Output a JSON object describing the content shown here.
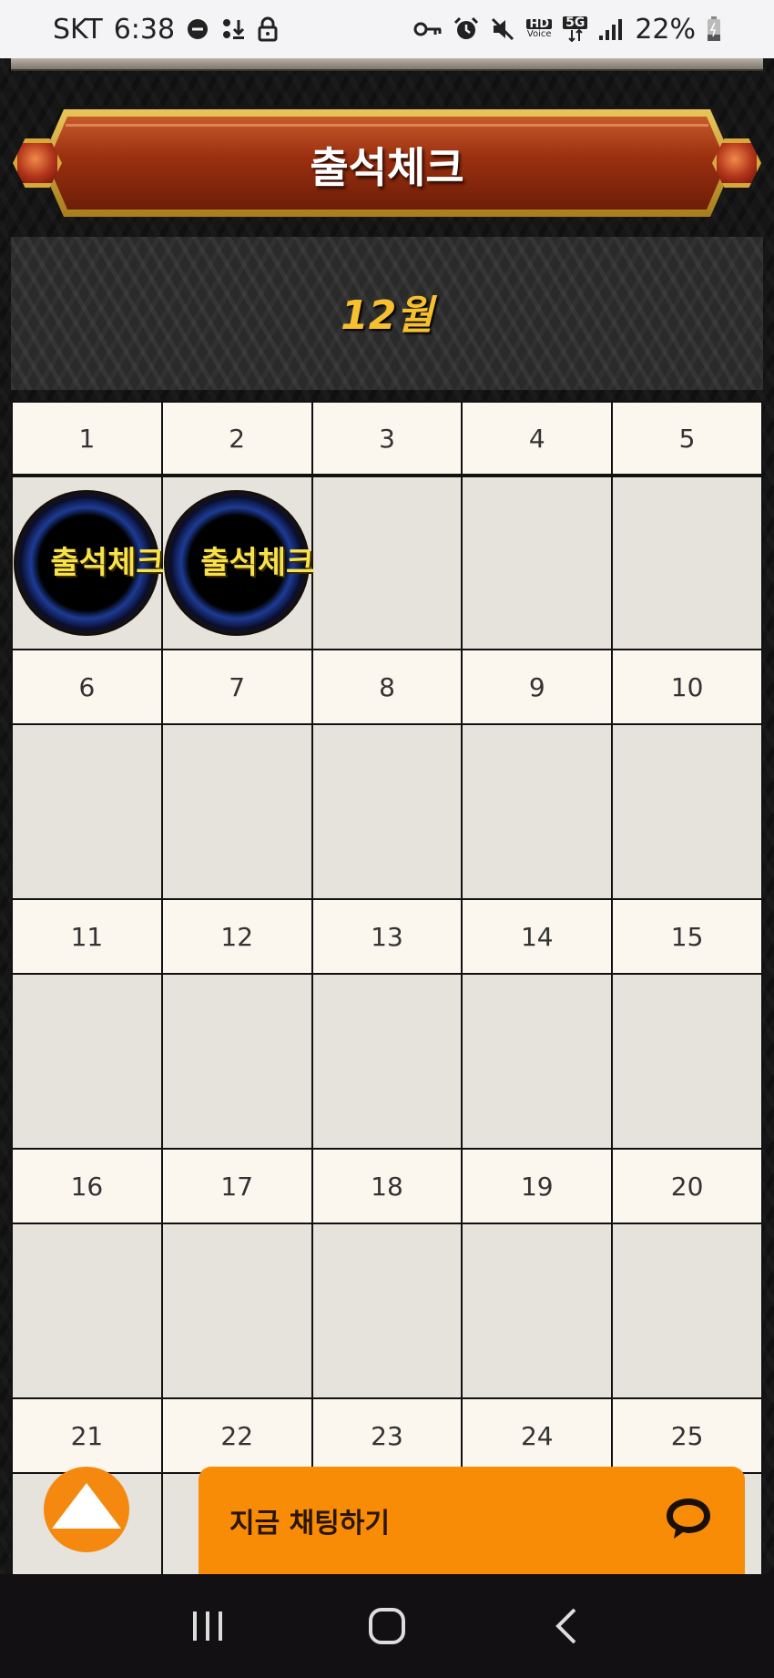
{
  "status_bar": {
    "carrier": "SKT",
    "time": "6:38",
    "battery": "22%",
    "icons_left": [
      "do-not-disturb-icon",
      "download-icon",
      "lock-icon"
    ],
    "icons_right": [
      "vpn-key-icon",
      "alarm-icon",
      "mute-icon",
      "hd-voice-icon",
      "5g-icon",
      "signal-icon",
      "battery-icon"
    ],
    "hd_label_top": "HD",
    "hd_label_bottom": "Voice",
    "network_label": "5G"
  },
  "banner": {
    "title": "출석체크"
  },
  "month": {
    "label": "12월"
  },
  "calendar": {
    "weeks": [
      {
        "dates": [
          "1",
          "2",
          "3",
          "4",
          "5"
        ],
        "stamped": [
          true,
          true,
          false,
          false,
          false
        ]
      },
      {
        "dates": [
          "6",
          "7",
          "8",
          "9",
          "10"
        ],
        "stamped": [
          false,
          false,
          false,
          false,
          false
        ]
      },
      {
        "dates": [
          "11",
          "12",
          "13",
          "14",
          "15"
        ],
        "stamped": [
          false,
          false,
          false,
          false,
          false
        ]
      },
      {
        "dates": [
          "16",
          "17",
          "18",
          "19",
          "20"
        ],
        "stamped": [
          false,
          false,
          false,
          false,
          false
        ]
      },
      {
        "dates": [
          "21",
          "22",
          "23",
          "24",
          "25"
        ],
        "stamped": [
          false,
          false,
          false,
          false,
          false
        ]
      }
    ],
    "stamp_text": "출석체크"
  },
  "floating": {
    "scroll_top_icon": "arrow-up-icon",
    "chat_label": "지금 채팅하기",
    "chat_icon": "chat-bubble-icon",
    "accent_color": "#f88c07"
  },
  "nav_bar": {
    "buttons": [
      "recent-apps-icon",
      "home-icon",
      "back-icon"
    ]
  }
}
